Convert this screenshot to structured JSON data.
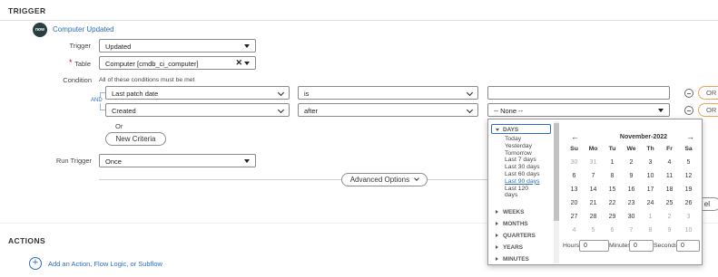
{
  "trigger_section": {
    "title": "TRIGGER"
  },
  "trigger_card": {
    "badge": "now",
    "title": "Computer Updated",
    "trigger_label": "Trigger",
    "trigger_value": "Updated",
    "table_label": "Table",
    "required_marker": "*",
    "table_value": "Computer [cmdb_ci_computer]",
    "clear_glyph": "✕",
    "condition_label": "Condition",
    "condition_hint": "All of these conditions must be met",
    "and_label": "AND",
    "conditions": [
      {
        "field": "Last patch date",
        "operator": "is",
        "value": ""
      },
      {
        "field": "Created",
        "operator": "after",
        "value": "-- None --"
      }
    ],
    "or_label": "Or",
    "or_button": "OR",
    "new_criteria": "New Criteria",
    "run_trigger_label": "Run Trigger",
    "run_trigger_value": "Once",
    "advanced_options": "Advanced Options",
    "cancel_partial": "el"
  },
  "actions_section": {
    "title": "ACTIONS",
    "add_label": "Add an Action, Flow Logic, or Subflow",
    "add_glyph": "+"
  },
  "date_picker": {
    "days_group": "DAYS",
    "days_items": [
      "Today",
      "Yesterday",
      "Tomorrow",
      "Last 7 days",
      "Last 30 days",
      "Last 60 days",
      "Last 90 days",
      "Last 120",
      "days"
    ],
    "selected_item": "Last 90 days",
    "groups": [
      "WEEKS",
      "MONTHS",
      "QUARTERS",
      "YEARS",
      "MINUTES"
    ],
    "month_title": "November-2022",
    "prev_glyph": "←",
    "next_glyph": "→",
    "weekdays": [
      "Su",
      "Mo",
      "Tu",
      "We",
      "Th",
      "Fr",
      "Sa"
    ],
    "weeks": [
      [
        "30",
        "31",
        "1",
        "2",
        "3",
        "4",
        "5"
      ],
      [
        "6",
        "7",
        "8",
        "9",
        "10",
        "11",
        "12"
      ],
      [
        "13",
        "14",
        "15",
        "16",
        "17",
        "18",
        "19"
      ],
      [
        "20",
        "21",
        "22",
        "23",
        "24",
        "25",
        "26"
      ],
      [
        "27",
        "28",
        "29",
        "30",
        "1",
        "2",
        "3"
      ],
      [
        "4",
        "5",
        "6",
        "7",
        "8",
        "9",
        "10"
      ]
    ],
    "hours_label": "Hours",
    "hours_value": "0",
    "minutes_label": "Minutes",
    "minutes_value": "0",
    "seconds_label": "Seconds",
    "seconds_value": "0"
  },
  "colors": {
    "accent_blue": "#2c6fb7",
    "or_border": "#e8a45d",
    "required_red": "#d0021b",
    "muted_day": "#a8a8a8"
  }
}
